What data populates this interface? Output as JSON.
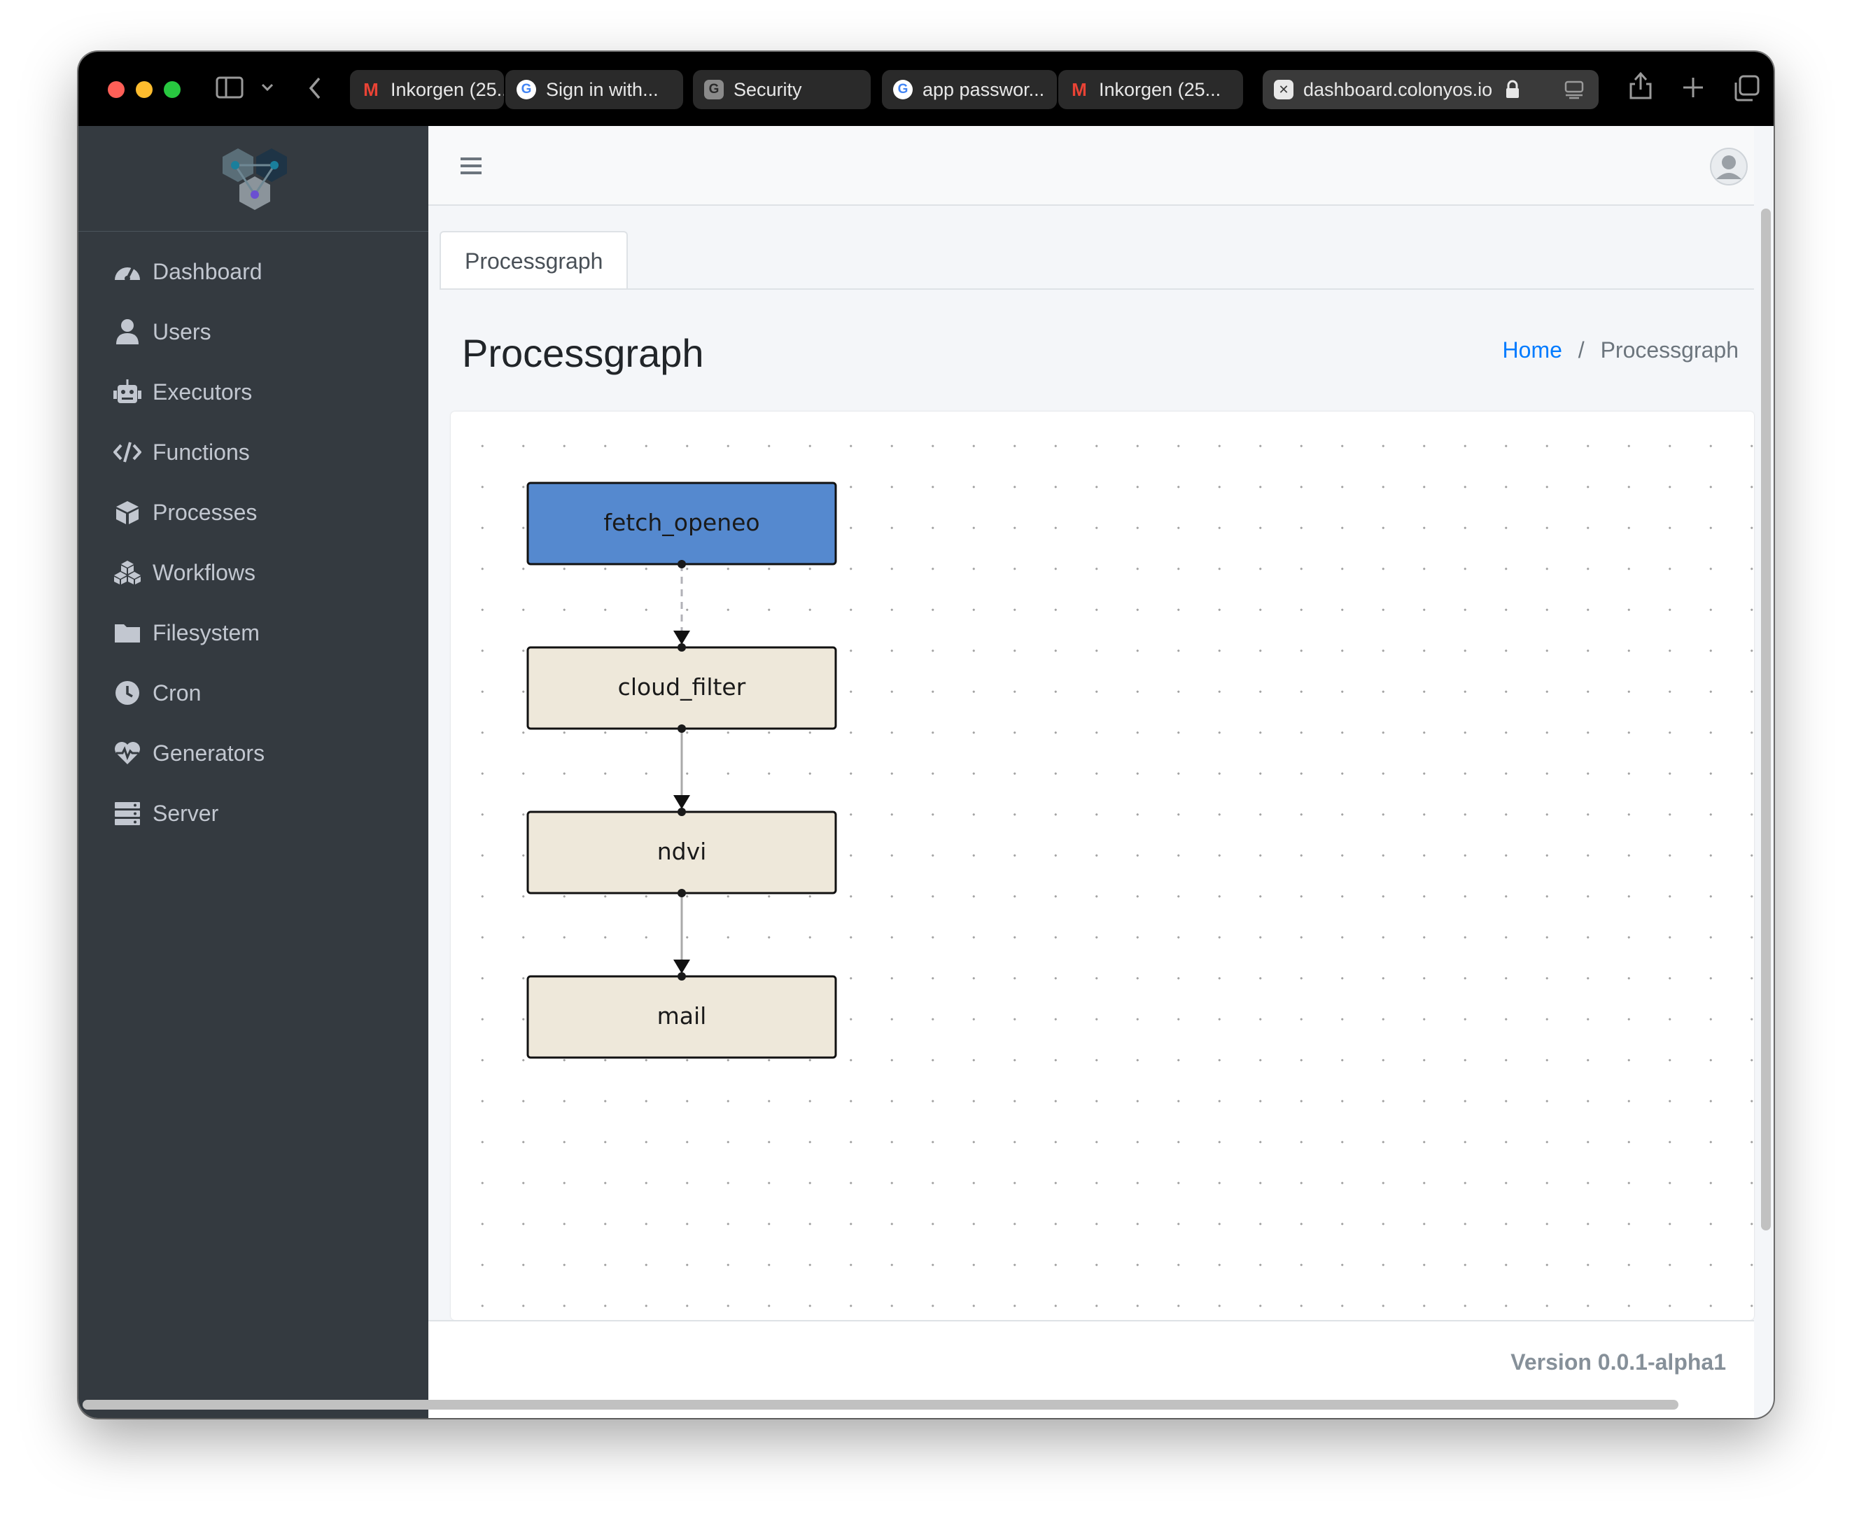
{
  "browser": {
    "tabs": [
      {
        "title": "Inkorgen (25...",
        "favicon": "gmail-icon"
      },
      {
        "title": "Sign in with...",
        "favicon": "google-icon"
      },
      {
        "title": "Security",
        "favicon": "g-icon"
      },
      {
        "title": "app passwor...",
        "favicon": "google-icon"
      },
      {
        "title": "Inkorgen (25...",
        "favicon": "gmail-icon"
      },
      {
        "title": "dashboard.colonyos.io",
        "favicon": "close-tab-icon",
        "active": true
      }
    ]
  },
  "sidebar": {
    "items": [
      {
        "label": "Dashboard",
        "icon": "speedometer-icon"
      },
      {
        "label": "Users",
        "icon": "user-icon"
      },
      {
        "label": "Executors",
        "icon": "robot-icon"
      },
      {
        "label": "Functions",
        "icon": "code-icon"
      },
      {
        "label": "Processes",
        "icon": "cube-icon"
      },
      {
        "label": "Workflows",
        "icon": "cubes-icon"
      },
      {
        "label": "Filesystem",
        "icon": "folder-icon"
      },
      {
        "label": "Cron",
        "icon": "clock-icon"
      },
      {
        "label": "Generators",
        "icon": "heartbeat-icon"
      },
      {
        "label": "Server",
        "icon": "server-icon"
      }
    ]
  },
  "content": {
    "tab_label": "Processgraph",
    "page_title": "Processgraph",
    "breadcrumb": {
      "home": "Home",
      "separator": "/",
      "current": "Processgraph"
    }
  },
  "graph": {
    "nodes": [
      {
        "id": "fetch_openeo",
        "label": "fetch_openeo",
        "color": "#5589cf",
        "highlighted": true
      },
      {
        "id": "cloud_filter",
        "label": "cloud_filter",
        "color": "#eee8da"
      },
      {
        "id": "ndvi",
        "label": "ndvi",
        "color": "#eee8da"
      },
      {
        "id": "mail",
        "label": "mail",
        "color": "#eee8da"
      }
    ],
    "edges": [
      {
        "from": "fetch_openeo",
        "to": "cloud_filter",
        "style": "dashed"
      },
      {
        "from": "cloud_filter",
        "to": "ndvi",
        "style": "solid"
      },
      {
        "from": "ndvi",
        "to": "mail",
        "style": "solid"
      }
    ]
  },
  "footer": {
    "version": "Version 0.0.1-alpha1"
  },
  "colors": {
    "sidebar_bg": "#343a40",
    "link": "#007bff",
    "node_highlight": "#5589cf",
    "node_default": "#eee8da"
  }
}
